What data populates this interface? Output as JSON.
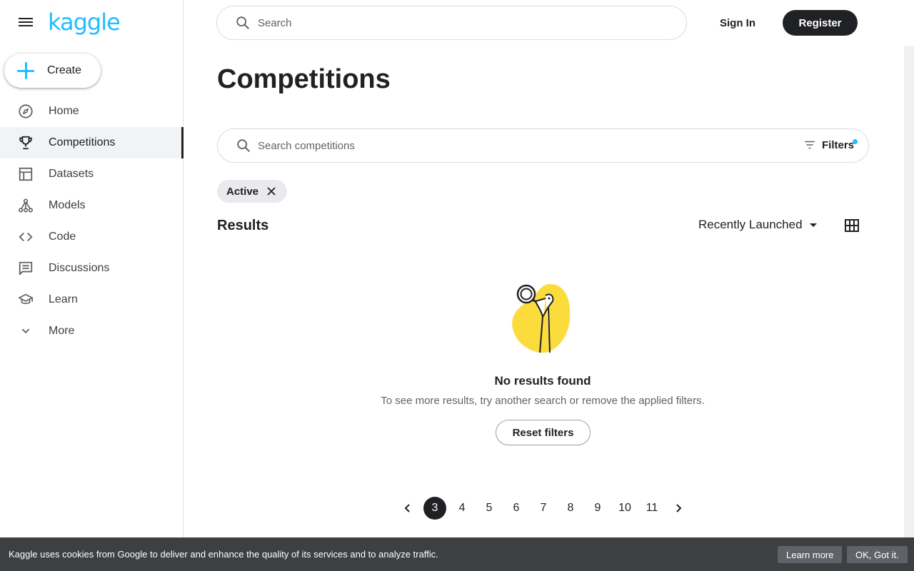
{
  "app": {
    "logo": "kaggle"
  },
  "header": {
    "search_placeholder": "Search",
    "signin_label": "Sign In",
    "register_label": "Register"
  },
  "sidebar": {
    "create_label": "Create",
    "items": [
      {
        "label": "Home",
        "icon": "compass-icon",
        "active": false
      },
      {
        "label": "Competitions",
        "icon": "trophy-icon",
        "active": true
      },
      {
        "label": "Datasets",
        "icon": "table-icon",
        "active": false
      },
      {
        "label": "Models",
        "icon": "models-icon",
        "active": false
      },
      {
        "label": "Code",
        "icon": "code-icon",
        "active": false
      },
      {
        "label": "Discussions",
        "icon": "discussion-icon",
        "active": false
      },
      {
        "label": "Learn",
        "icon": "school-icon",
        "active": false
      },
      {
        "label": "More",
        "icon": "chevron-down-icon",
        "active": false
      }
    ]
  },
  "main": {
    "title": "Competitions",
    "search_placeholder": "Search competitions",
    "filters_label": "Filters",
    "active_chip": "Active",
    "results_label": "Results",
    "sort_label": "Recently Launched",
    "empty": {
      "title": "No results found",
      "subtitle": "To see more results, try another search or remove the applied filters.",
      "reset_label": "Reset filters"
    },
    "pagination": {
      "pages": [
        "3",
        "4",
        "5",
        "6",
        "7",
        "8",
        "9",
        "10",
        "11"
      ],
      "current": "3"
    }
  },
  "cookie_bar": {
    "text": "Kaggle uses cookies from Google to deliver and enhance the quality of its services and to analyze traffic.",
    "learn_more": "Learn more",
    "ok": "OK, Got it."
  },
  "colors": {
    "brand": "#20beff",
    "dark": "#202124",
    "illustration_yellow": "#fbdc3c"
  }
}
